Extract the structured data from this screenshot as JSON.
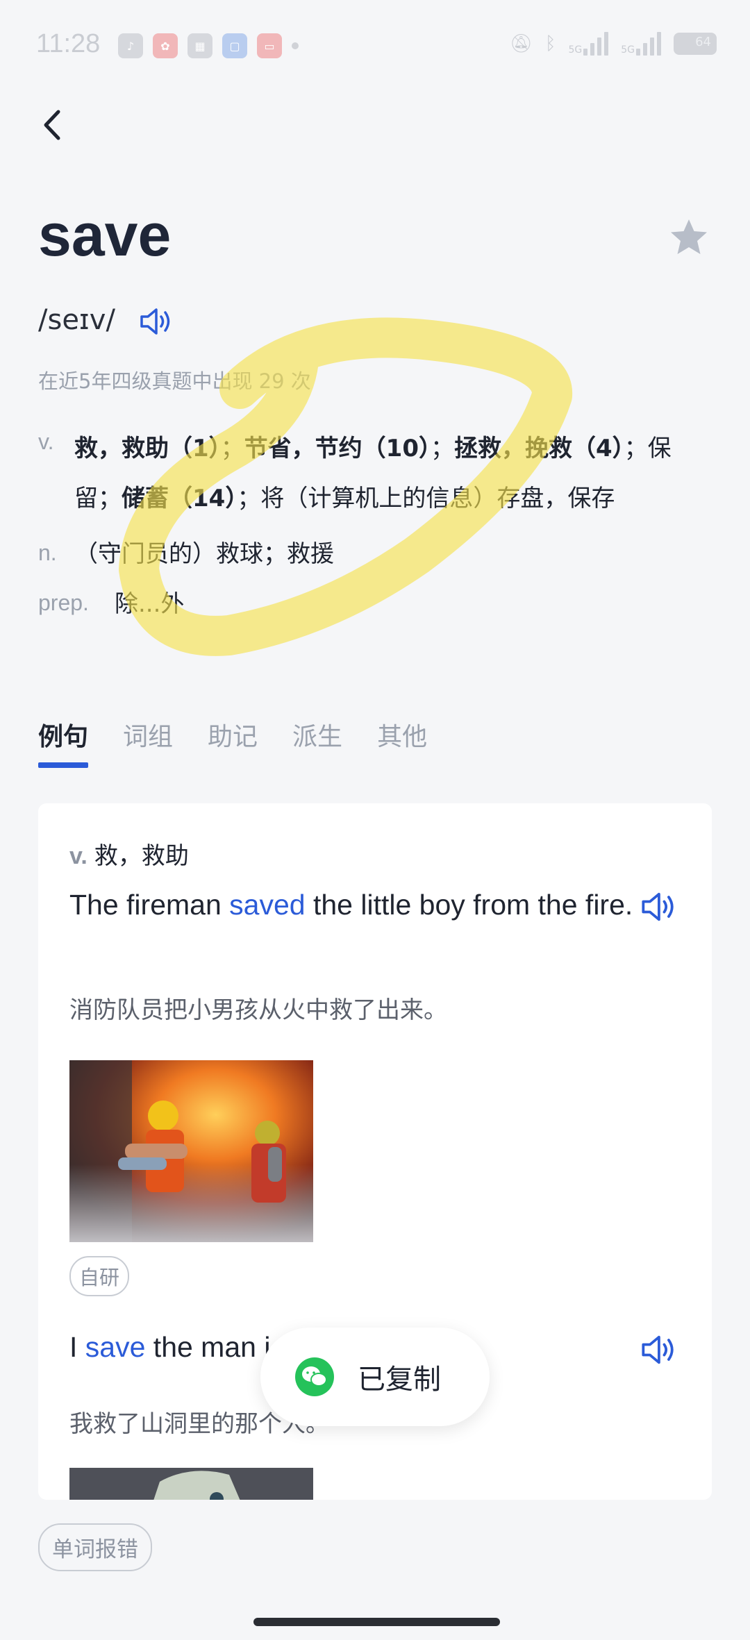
{
  "status_bar": {
    "time": "11:28",
    "network_label_1": "5G",
    "network_label_2": "5G",
    "battery_text": "64"
  },
  "header": {
    "word": "save",
    "phonetic": "/seɪv/",
    "frequency_text": "在近5年四级真题中出现 29 次"
  },
  "definitions": [
    {
      "pos": "v.",
      "segments": [
        {
          "text": "救，救助（1）",
          "bold": true
        },
        {
          "text": "；",
          "bold": false
        },
        {
          "text": "节省，节约（10）",
          "bold": true
        },
        {
          "text": "；",
          "bold": false
        },
        {
          "text": "拯救，挽救（4）",
          "bold": true
        },
        {
          "text": "；保留；",
          "bold": false
        },
        {
          "text": "储蓄（14）",
          "bold": true
        },
        {
          "text": "；将（计算机上的信息）存盘，保存",
          "bold": false
        }
      ]
    },
    {
      "pos": "n.",
      "text": "（守门员的）救球；救援"
    },
    {
      "pos": "prep.",
      "text": "除...外"
    }
  ],
  "tabs": [
    {
      "label": "例句",
      "active": true
    },
    {
      "label": "词组",
      "active": false
    },
    {
      "label": "助记",
      "active": false
    },
    {
      "label": "派生",
      "active": false
    },
    {
      "label": "其他",
      "active": false
    }
  ],
  "examples": [
    {
      "pos": "v.",
      "meaning": "救，救助",
      "en_before": "The fireman ",
      "en_highlight": "saved",
      "en_after": " the little boy from the fire.",
      "zh": "消防队员把小男孩从火中救了出来。",
      "tag": "自研"
    },
    {
      "en_before": "I ",
      "en_highlight": "save",
      "en_after": " the man i",
      "zh": "我救了山洞里的那个人。"
    }
  ],
  "toast": {
    "text": "已复制",
    "icon": "wechat-icon"
  },
  "footer": {
    "report_label": "单词报错"
  },
  "colors": {
    "accent": "#2b5bd8",
    "marker": "#f5e04a",
    "toast_icon": "#25c25a"
  }
}
